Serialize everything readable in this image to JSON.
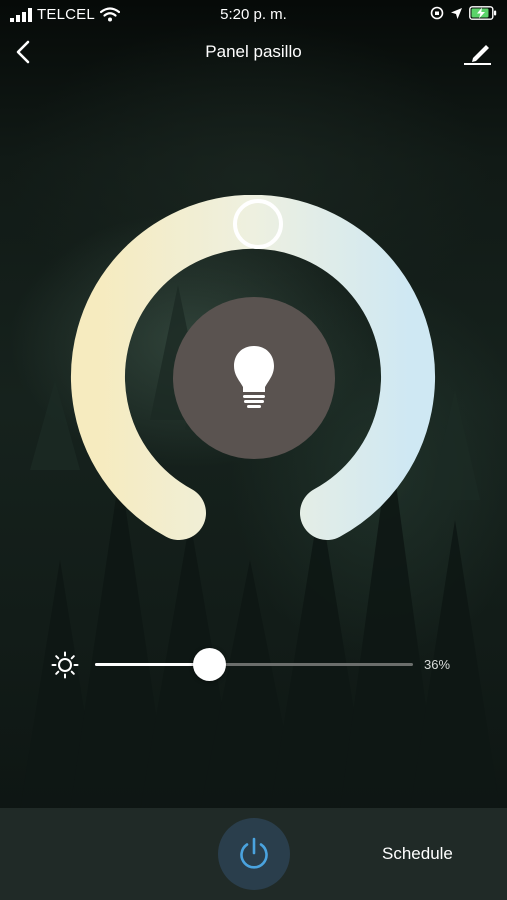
{
  "status_bar": {
    "carrier": "TELCEL",
    "time": "5:20 p. m.",
    "icons": [
      "signal-bars-icon",
      "wifi-icon",
      "orientation-lock-icon",
      "location-arrow-icon",
      "battery-charging-icon"
    ]
  },
  "nav": {
    "title": "Panel pasillo",
    "back_icon": "chevron-left-icon",
    "edit_icon": "pencil-icon"
  },
  "color_temperature": {
    "warm_color": "#f6ebbf",
    "cool_color": "#cfe8f3",
    "center_icon": "light-bulb-icon",
    "center_color": "#5a5350"
  },
  "brightness": {
    "icon": "brightness-sun-icon",
    "value_label": "36%",
    "level": 0.36
  },
  "bottom_bar": {
    "power_icon": "power-icon",
    "power_color": "#4aa3df",
    "schedule_label": "Schedule"
  }
}
